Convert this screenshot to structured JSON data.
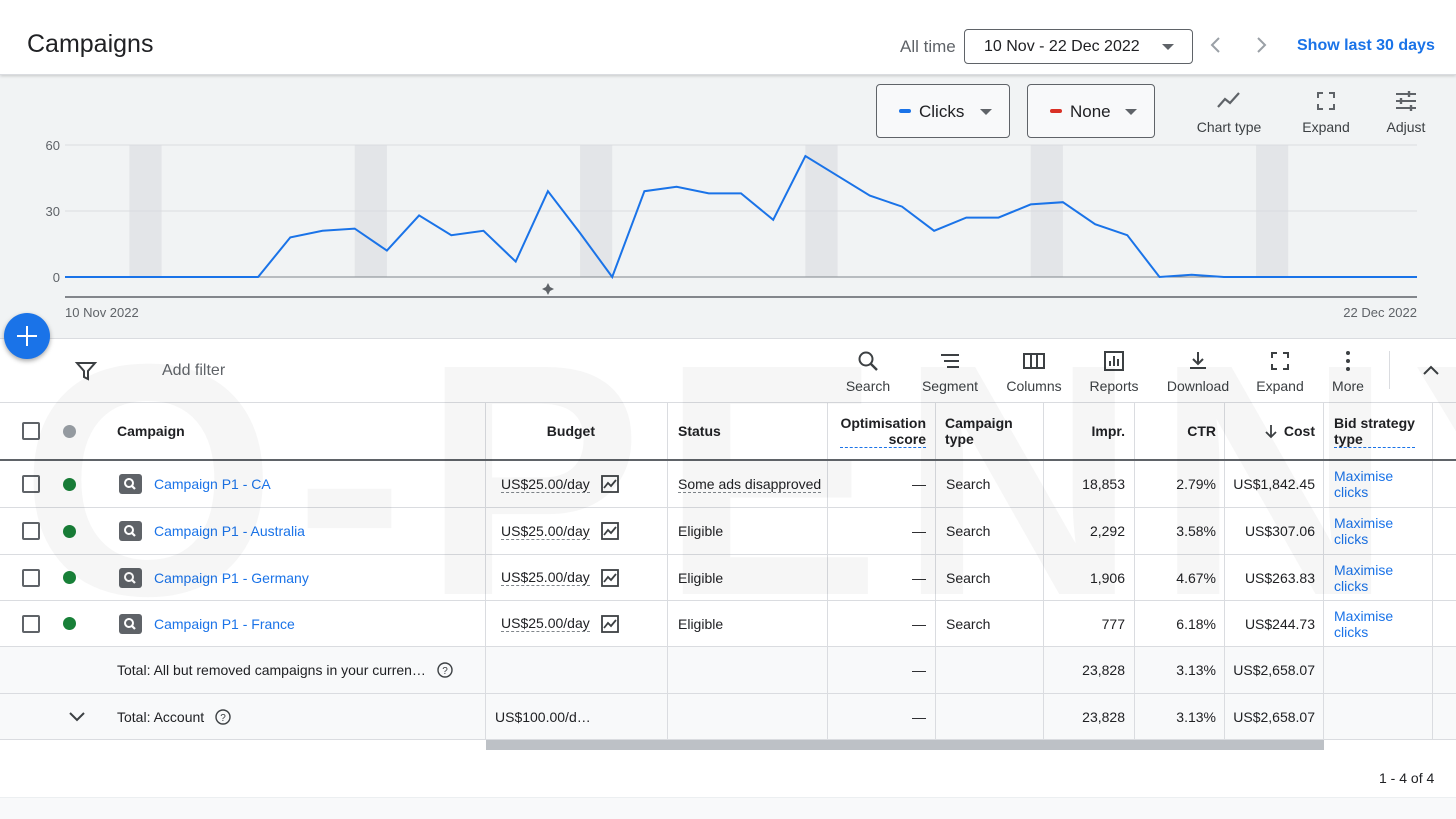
{
  "header": {
    "title": "Campaigns",
    "range_label": "All time",
    "date_range": "10 Nov - 22 Dec 2022",
    "show_last": "Show last 30 days"
  },
  "chart_controls": {
    "metric1": {
      "label": "Clicks",
      "color": "#1a73e8"
    },
    "metric2": {
      "label": "None",
      "color": "#d93025"
    },
    "tools": [
      {
        "label": "Chart type",
        "icon": "chart-type-icon"
      },
      {
        "label": "Expand",
        "icon": "expand-icon"
      },
      {
        "label": "Adjust",
        "icon": "adjust-icon"
      }
    ]
  },
  "chart_data": {
    "type": "line",
    "x_start_label": "10 Nov 2022",
    "x_end_label": "22 Dec 2022",
    "yticks": [
      0,
      30,
      60
    ],
    "ylim": [
      0,
      60
    ],
    "grid": true,
    "series": [
      {
        "values": [
          0,
          0,
          0,
          0,
          0,
          0,
          0,
          18,
          21,
          22,
          12,
          28,
          19,
          21,
          7,
          39,
          20,
          0,
          39,
          41,
          38,
          38,
          26,
          55,
          46,
          37,
          32,
          21,
          27,
          27,
          33,
          34,
          24,
          19,
          0,
          1,
          0,
          0,
          0,
          0,
          0,
          0,
          0
        ],
        "color": "#1a73e8"
      }
    ]
  },
  "toolbar": {
    "add_filter": "Add filter",
    "tools": [
      {
        "label": "Search",
        "icon": "search-icon"
      },
      {
        "label": "Segment",
        "icon": "segment-icon"
      },
      {
        "label": "Columns",
        "icon": "columns-icon"
      },
      {
        "label": "Reports",
        "icon": "reports-icon"
      },
      {
        "label": "Download",
        "icon": "download-icon"
      },
      {
        "label": "Expand",
        "icon": "expand-icon"
      },
      {
        "label": "More",
        "icon": "more-vert-icon"
      }
    ]
  },
  "table": {
    "headers": {
      "campaign": "Campaign",
      "budget": "Budget",
      "status": "Status",
      "opt_score_1": "Optimisation",
      "opt_score_2": "score",
      "camp_type_1": "Campaign",
      "camp_type_2": "type",
      "impr": "Impr.",
      "ctr": "CTR",
      "cost": "Cost",
      "bid_1": "Bid strategy",
      "bid_2": "type"
    },
    "rows": [
      {
        "campaign": "Campaign P1 - CA",
        "budget": "US$25.00/day",
        "status": "Some ads disapproved",
        "opt": "—",
        "type": "Search",
        "impr": "18,853",
        "ctr": "2.79%",
        "cost": "US$1,842.45",
        "bid_1": "Maximise",
        "bid_2": "clicks"
      },
      {
        "campaign": "Campaign P1 - Australia",
        "budget": "US$25.00/day",
        "status": "Eligible",
        "opt": "—",
        "type": "Search",
        "impr": "2,292",
        "ctr": "3.58%",
        "cost": "US$307.06",
        "bid_1": "Maximise",
        "bid_2": "clicks"
      },
      {
        "campaign": "Campaign P1 - Germany",
        "budget": "US$25.00/day",
        "status": "Eligible",
        "opt": "—",
        "type": "Search",
        "impr": "1,906",
        "ctr": "4.67%",
        "cost": "US$263.83",
        "bid_1": "Maximise",
        "bid_2": "clicks"
      },
      {
        "campaign": "Campaign P1 - France",
        "budget": "US$25.00/day",
        "status": "Eligible",
        "opt": "—",
        "type": "Search",
        "impr": "777",
        "ctr": "6.18%",
        "cost": "US$244.73",
        "bid_1": "Maximise",
        "bid_2": "clicks"
      }
    ],
    "total_campaigns": {
      "label": "Total: All but removed campaigns in your curren…",
      "opt": "—",
      "impr": "23,828",
      "ctr": "3.13%",
      "cost": "US$2,658.07"
    },
    "total_account": {
      "label": "Total: Account",
      "budget": "US$100.00/d…",
      "opt": "—",
      "impr": "23,828",
      "ctr": "3.13%",
      "cost": "US$2,658.07"
    }
  },
  "pager": "1 - 4 of 4",
  "watermark": "O-PENNY",
  "colors": {
    "accent": "#1a73e8",
    "enabled_dot": "#188038",
    "header_dot": "#9aa0a6"
  }
}
